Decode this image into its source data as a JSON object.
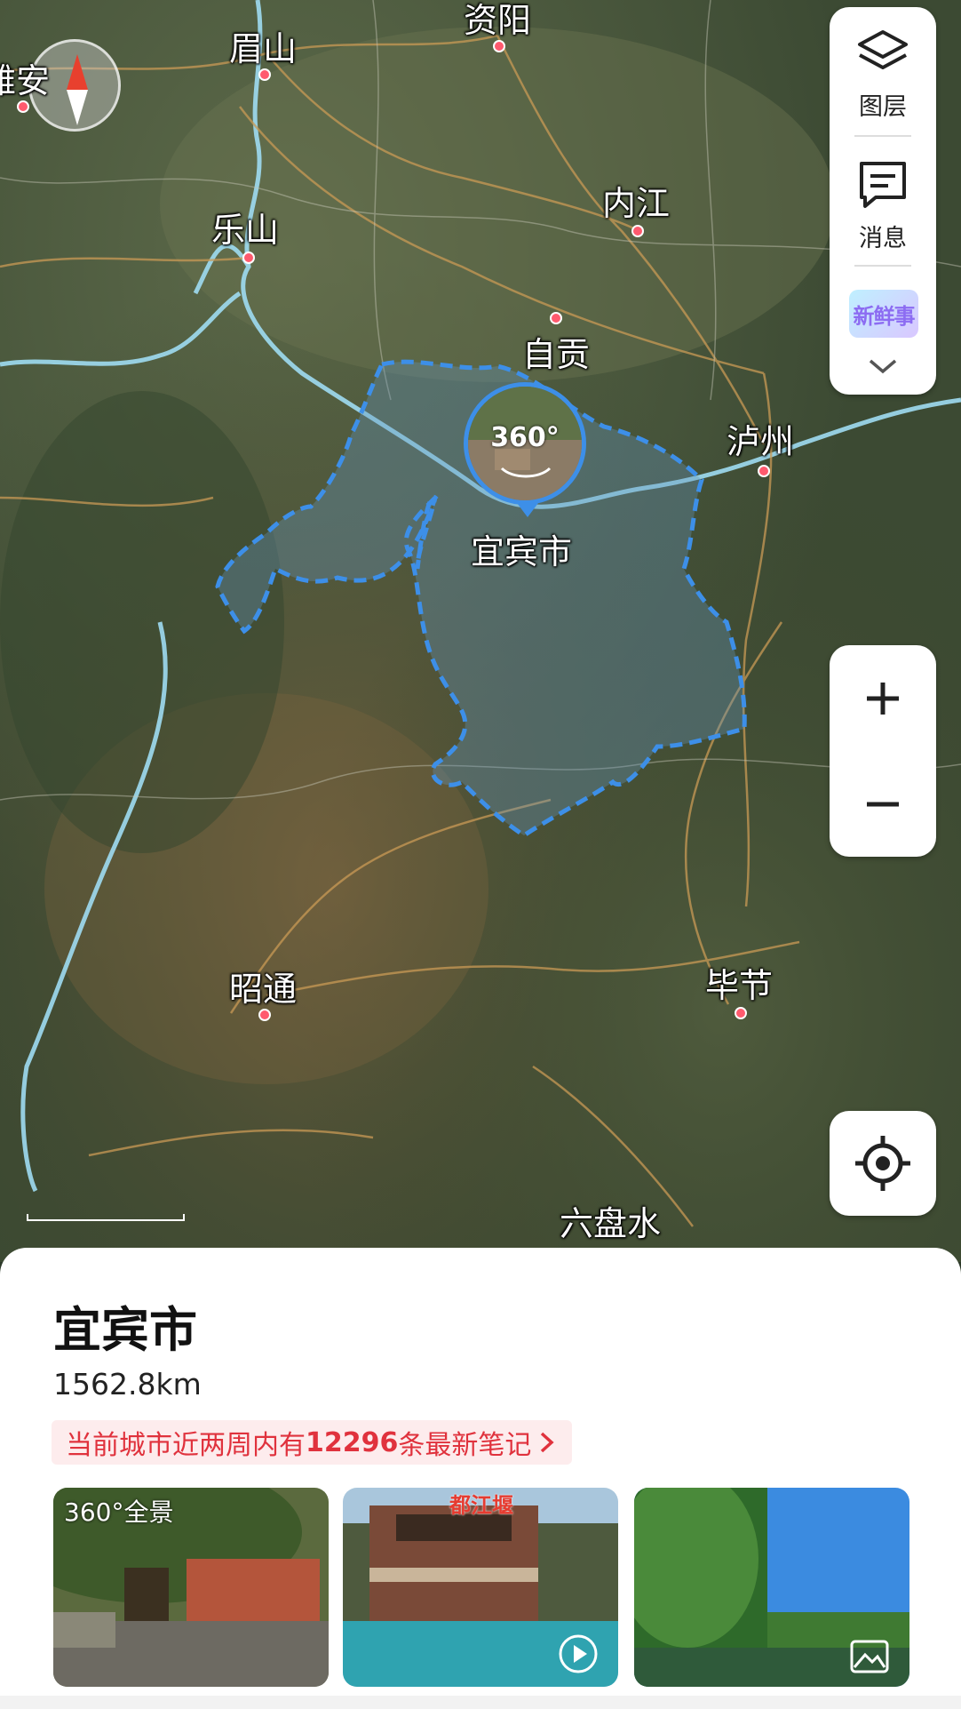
{
  "map": {
    "cities": [
      {
        "key": "yaan",
        "label": "雅安"
      },
      {
        "key": "meishan",
        "label": "眉山"
      },
      {
        "key": "ziyang",
        "label": "资阳"
      },
      {
        "key": "leshan",
        "label": "乐山"
      },
      {
        "key": "neijiang",
        "label": "内江"
      },
      {
        "key": "zigong",
        "label": "自贡"
      },
      {
        "key": "luzhou",
        "label": "泸州"
      },
      {
        "key": "yibin",
        "label": "宜宾市"
      },
      {
        "key": "zhaotong",
        "label": "昭通"
      },
      {
        "key": "bijie",
        "label": "毕节"
      },
      {
        "key": "liupanshui",
        "label": "六盘水"
      }
    ],
    "pano_label": "360°"
  },
  "side_panel": {
    "layers_label": "图层",
    "messages_label": "消息",
    "badge_text": "新鲜事"
  },
  "sheet": {
    "title": "宜宾市",
    "distance": "1562.8km",
    "notes_prefix": "当前城市近两周内有",
    "notes_count": "12296",
    "notes_suffix": "条最新笔记",
    "thumbs": [
      {
        "label": "360°全景",
        "type": "pano"
      },
      {
        "label": "都江堰",
        "type": "video"
      },
      {
        "label": "",
        "type": "image"
      }
    ]
  },
  "colors": {
    "boundary": "#3d8fe8",
    "city_dot": "#ff5a6e",
    "notes_text": "#e0323d"
  }
}
